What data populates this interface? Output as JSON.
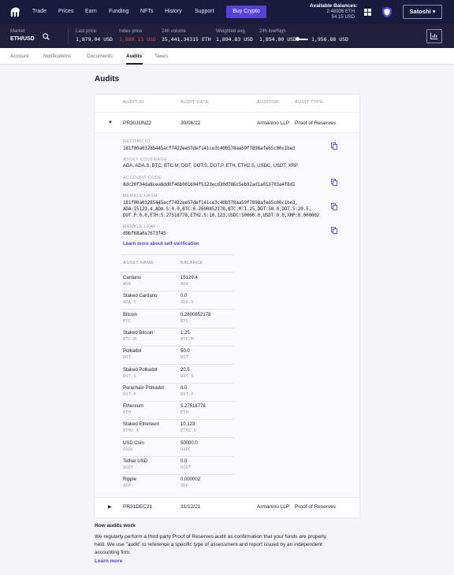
{
  "nav": {
    "links": [
      "Trade",
      "Prices",
      "Earn",
      "Funding",
      "NFTs",
      "History",
      "Support"
    ],
    "buy_label": "Buy Crypto",
    "balances_title": "Available Balances:",
    "balance_eth": "2.48936 ETH",
    "balance_usd": "54.15 USD",
    "account_label": "Satoshi",
    "account_caret": "▾"
  },
  "ticker": {
    "market_label": "Market",
    "pair": "ETH/USD",
    "last_price_label": "Last price",
    "last_price": "1,879.04 USD",
    "index_price_label": "Index price",
    "index_price": "1,880.13 USD",
    "volume_label": "24h volume",
    "volume": "35,441.34315 ETH",
    "weighted_label": "Weighted avg.",
    "weighted": "1,894.83 USD",
    "lowhigh_label": "24h low/high",
    "low": "1,854.00 USD",
    "high": "1,956.88 USD",
    "colors": {
      "index_price": "#e5484d"
    }
  },
  "subtabs": [
    "Account",
    "Notifications",
    "Documents",
    "Audits",
    "Taxes"
  ],
  "page_title": "Audits",
  "table": {
    "headers": [
      "AUDIT ID",
      "AUDIT DATE",
      "AUDITOR",
      "AUDIT TYPE"
    ],
    "rows": [
      {
        "id": "PR30JUN22",
        "date": "30/06/22",
        "auditor": "Armanino LLP",
        "type": "Proof of Reserves",
        "expanded": true,
        "caret": "▼"
      },
      {
        "id": "PR31DEC21",
        "date": "31/12/21",
        "auditor": "Armanino LLP",
        "type": "Proof of Reserves",
        "expanded": false,
        "caret": "▶"
      }
    ]
  },
  "details": {
    "record_id_label": "RECORD ID",
    "record_id": "181f00a03285445acf7422ee57def141ce3c40b578aa59f7898afe65c00c1be3",
    "asset_coverage_label": "ASSET COVERAGE",
    "asset_coverage": "ADA, ADA.S, BTC, BTC.M, DOT, DOT.S, DOT.P, ETH, ETH2.S, USDC, USDT, XRP",
    "account_code_label": "ACCOUNT CODE",
    "account_code": "8dc20f34da8cea8dd0f46b001694f5123ecd30d786c5eb92ad1a013703a4f8d1",
    "merkle_hash_label": "MERKLE HASH",
    "merkle_hash_lines": [
      "181f00a03285445acf7422ee57def141ce3c40b578aa59f7898afe65c00c1be3,",
      "ADA:15129.4,ADA.S:0.0,BTC:0.2600852178,BTC.M:1.25,DOT:50.0,DOT.S:20.5,",
      "DOT.P:0.0,ETH:5.27518778,ETH2.S:10.123,USDC:50000.0,USDT:0.0,XRP:0.000002"
    ],
    "merkle_leaf_label": "MERKLE LEAF",
    "merkle_leaf": "d9bf68a0a7673f45",
    "verify_link": "Learn more about self-verification",
    "asset_headers": [
      "ASSET NAME",
      "BALANCE"
    ],
    "assets": [
      {
        "name": "Cardano",
        "symbol": "ADA",
        "balance": "15129.4",
        "balance_symbol": "ADA"
      },
      {
        "name": "Staked Cardano",
        "symbol": "ADA.S",
        "balance": "0.0",
        "balance_symbol": "ADA.S"
      },
      {
        "name": "Bitcoin",
        "symbol": "BTC",
        "balance": "0.2600852178",
        "balance_symbol": "BTC"
      },
      {
        "name": "Staked Bitcoin",
        "symbol": "BTC.M",
        "balance": "1.25",
        "balance_symbol": "BTC.M"
      },
      {
        "name": "Polkadot",
        "symbol": "DOT",
        "balance": "50.0",
        "balance_symbol": "DOT"
      },
      {
        "name": "Staked Polkadot",
        "symbol": "DOT.S",
        "balance": "20.5",
        "balance_symbol": "DOT.S"
      },
      {
        "name": "Parachain Polkadot",
        "symbol": "DOT.P",
        "balance": "0.0",
        "balance_symbol": "DOT.P"
      },
      {
        "name": "Ethereum",
        "symbol": "ETH",
        "balance": "5.27518778",
        "balance_symbol": "ETH"
      },
      {
        "name": "Staked Ethereum",
        "symbol": "ETH2.S",
        "balance": "10.123",
        "balance_symbol": "ETH2.S"
      },
      {
        "name": "USD Coin",
        "symbol": "USDC",
        "balance": "50000.0",
        "balance_symbol": "USDC"
      },
      {
        "name": "Tether USD",
        "symbol": "USDT",
        "balance": "0.0",
        "balance_symbol": "USDT"
      },
      {
        "name": "Ripple",
        "symbol": "XRP",
        "balance": "0.000002",
        "balance_symbol": "XRP"
      }
    ]
  },
  "how": {
    "title": "How audits work",
    "lines": [
      "We regularly perform a third-party Proof of Reserves audit as confirmation that your funds are properly",
      "held. We use \"audit\" to reference a specific type of assessment and report issued by an independent",
      "accounting firm."
    ],
    "learn_more": "Learn more"
  },
  "icons": [
    "kraken-logo-icon",
    "apps-grid-icon",
    "shield-icon",
    "search-icon",
    "chart-icon",
    "copy-icon"
  ],
  "colors": {
    "nav_bg": "#1a1a3d",
    "ticker_bg": "#20203d",
    "accent": "#5741d9"
  }
}
